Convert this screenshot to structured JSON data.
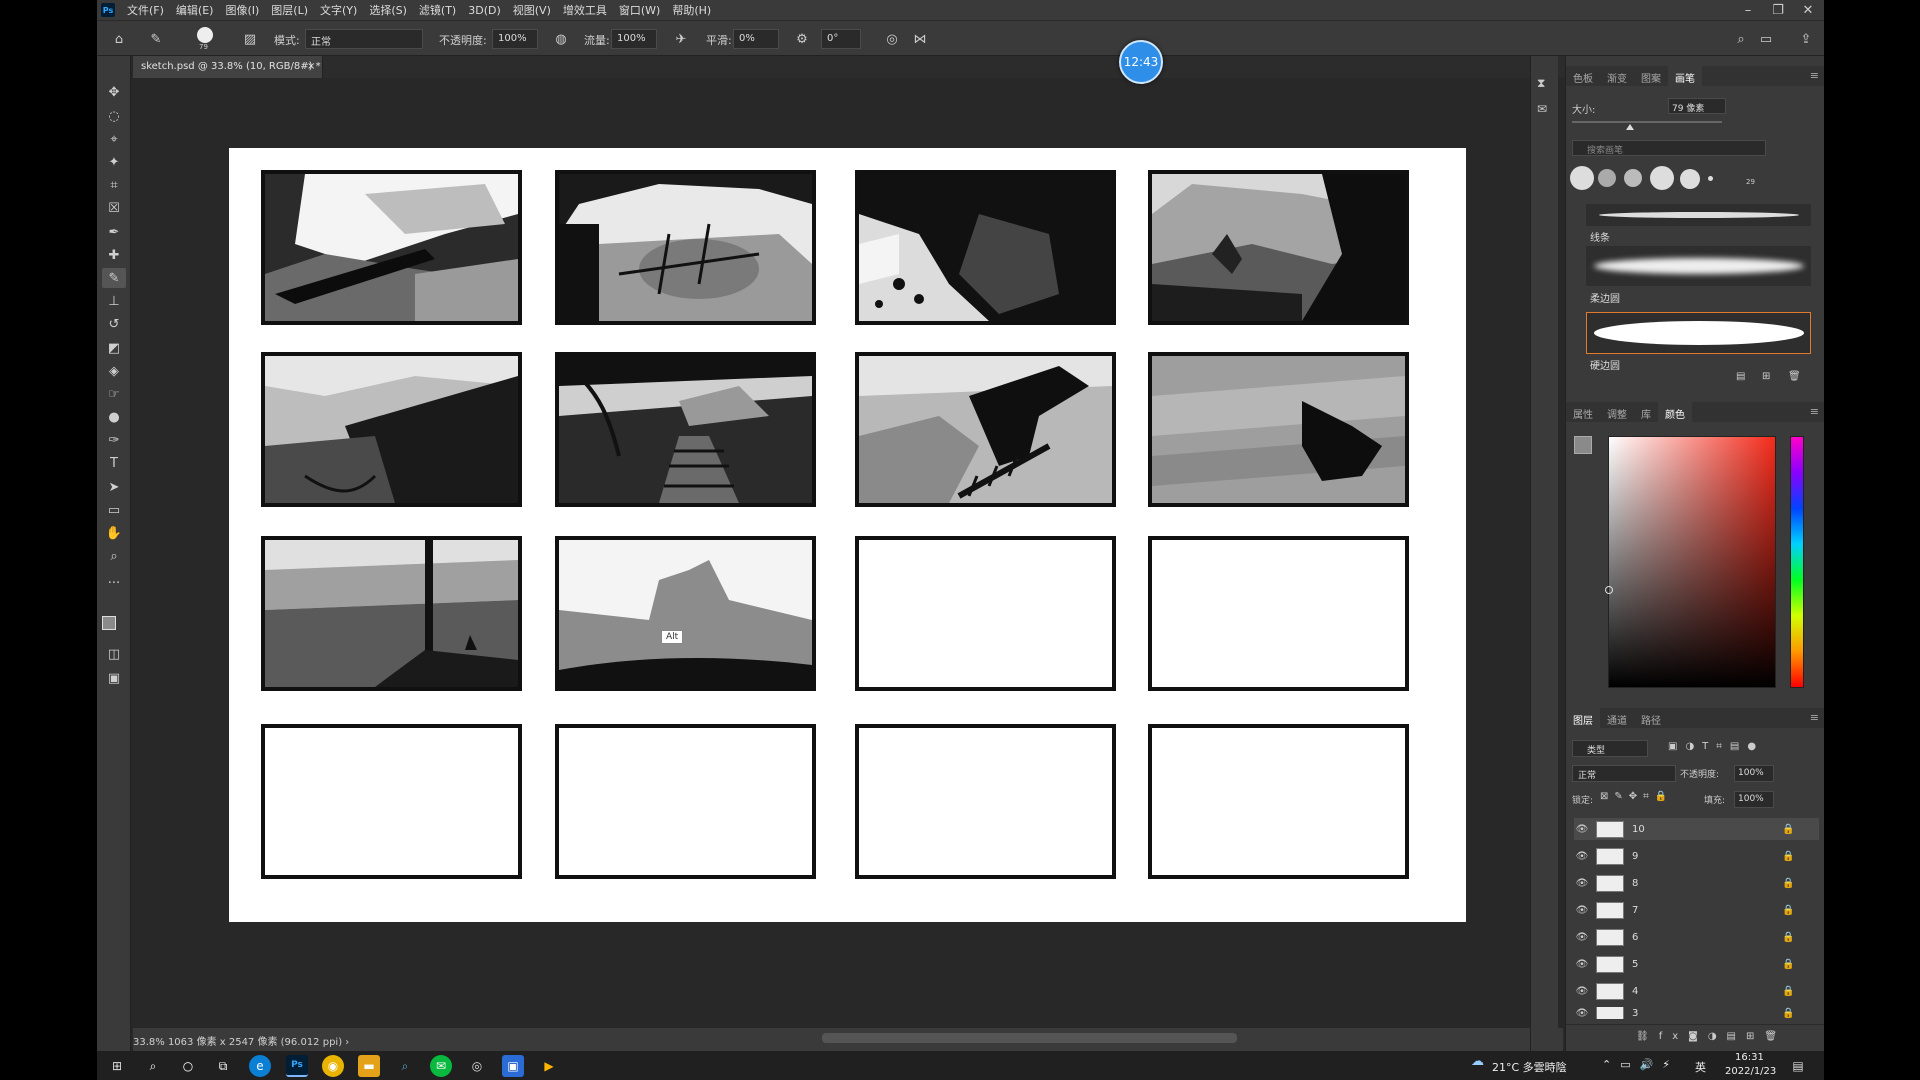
{
  "menu": {
    "logo": "Ps",
    "items": [
      "文件(F)",
      "编辑(E)",
      "图像(I)",
      "图层(L)",
      "文字(Y)",
      "选择(S)",
      "滤镜(T)",
      "3D(D)",
      "视图(V)",
      "增效工具",
      "窗口(W)",
      "帮助(H)"
    ]
  },
  "options": {
    "brush_size": "79",
    "mode_label": "模式:",
    "mode_value": "正常",
    "opacity_label": "不透明度:",
    "opacity_value": "100%",
    "flow_label": "流量:",
    "flow_value": "100%",
    "smooth_label": "平滑:",
    "smooth_value": "0%",
    "angle_value": "0°"
  },
  "timer": "12:43",
  "document": {
    "tab_title": "sketch.psd @ 33.8% (10, RGB/8#) *",
    "close": "×",
    "status": "33.8%  1063 像素 x 2547 像素 (96.012 ppi)  ›",
    "alt_tooltip": "Alt"
  },
  "brushes_panel": {
    "tabs": [
      "色板",
      "渐变",
      "图案",
      "画笔"
    ],
    "active_tab": "画笔",
    "size_label": "大小:",
    "size_value": "79 像素",
    "search_placeholder": "搜索画笔",
    "preset_size": "29",
    "brushes": [
      "线条",
      "柔边圆",
      "硬边圆"
    ]
  },
  "color_panel": {
    "tabs": [
      "属性",
      "调整",
      "库",
      "颜色"
    ],
    "active_tab": "颜色"
  },
  "layers_panel": {
    "tabs": [
      "图层",
      "通道",
      "路径"
    ],
    "active_tab": "图层",
    "filter_label": "类型",
    "blend_mode": "正常",
    "opacity_label": "不透明度:",
    "opacity_value": "100%",
    "lock_label": "锁定:",
    "fill_label": "填充:",
    "fill_value": "100%",
    "layers": [
      {
        "name": "10",
        "selected": true
      },
      {
        "name": "9",
        "selected": false
      },
      {
        "name": "8",
        "selected": false
      },
      {
        "name": "7",
        "selected": false
      },
      {
        "name": "6",
        "selected": false
      },
      {
        "name": "5",
        "selected": false
      },
      {
        "name": "4",
        "selected": false
      },
      {
        "name": "3",
        "selected": false
      }
    ]
  },
  "taskbar": {
    "weather": "21°C 多雲時陰",
    "ime": "英",
    "time": "16:31",
    "date": "2022/1/23"
  },
  "colors": {
    "accent": "#2f8ee8",
    "brush_selected": "#e07b2e",
    "ui_bg": "#3a3a3a"
  }
}
